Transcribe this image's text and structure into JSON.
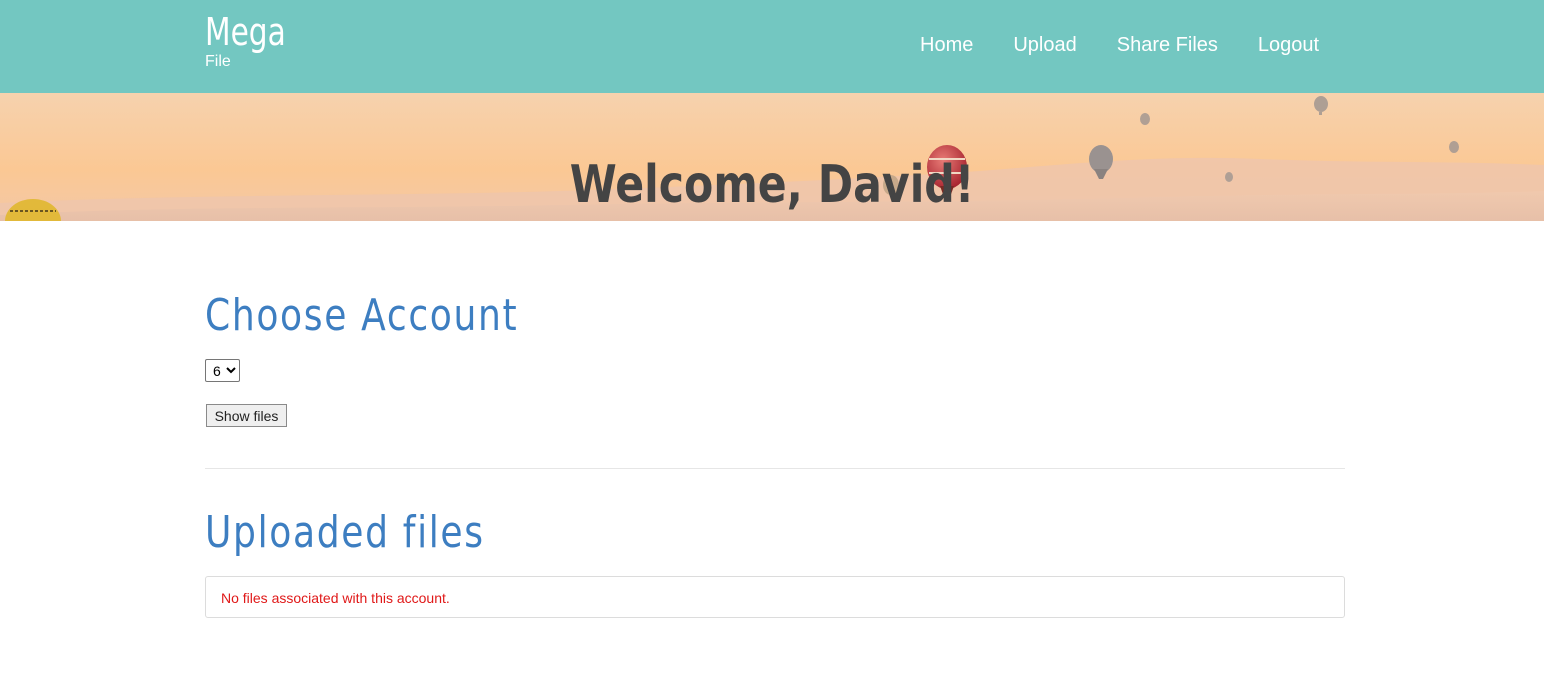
{
  "brand": {
    "title": "Mega",
    "subtitle": "File"
  },
  "nav": {
    "items": [
      {
        "label": "Home"
      },
      {
        "label": "Upload"
      },
      {
        "label": "Share Files"
      },
      {
        "label": "Logout"
      }
    ]
  },
  "hero": {
    "greeting": "Welcome, David!",
    "background": "hot-air-balloons-desert-sunset"
  },
  "choose_account": {
    "title": "Choose Account",
    "selected_account": "6",
    "options": [
      "6"
    ],
    "button_label": "Show files"
  },
  "uploaded_files": {
    "title": "Uploaded files",
    "empty_message": "No files associated with this account."
  },
  "colors": {
    "navbar": "#73c7c1",
    "heading": "#3d7ec1",
    "error_text": "#e01818",
    "hero_text": "#444444"
  }
}
